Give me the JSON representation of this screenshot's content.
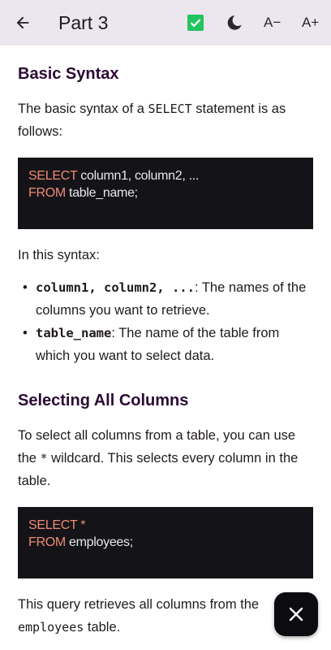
{
  "header": {
    "title": "Part 3",
    "font_decrease_label": "A−",
    "font_increase_label": "A+",
    "accent_check_color": "#22c55e"
  },
  "sections": [
    {
      "heading": "Basic Syntax",
      "intro_before": "The basic syntax of a ",
      "intro_code": "SELECT",
      "intro_after": " statement is as follows:",
      "code": {
        "line1_kw": "SELECT",
        "line1_rest": " column1, column2, ...",
        "line2_kw": "FROM",
        "line2_rest": " table_name;"
      },
      "syntax_label": "In this syntax:",
      "items": [
        {
          "term": "column1, column2, ...",
          "text": ": The names of the columns you want to retrieve."
        },
        {
          "term": "table_name",
          "text": ": The name of the table from which you want to select data."
        }
      ]
    },
    {
      "heading": "Selecting All Columns",
      "intro_before": "To select all columns from a table, you can use the ",
      "intro_code": "*",
      "intro_after": " wildcard. This selects every column in the table.",
      "code": {
        "line1_kw": "SELECT",
        "line1_rest": " *",
        "line2_kw": "FROM",
        "line2_rest": " employees;"
      },
      "outro_before": "This query retrieves all columns from the ",
      "outro_code": "employees",
      "outro_after": " table."
    }
  ]
}
